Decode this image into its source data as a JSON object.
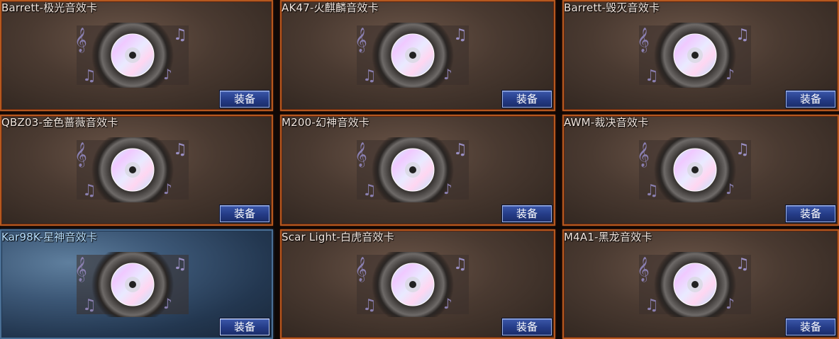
{
  "cards": [
    {
      "title": "Barrett-极光音效卡",
      "button": "装备",
      "icon": "music-disc-icon",
      "selected": false
    },
    {
      "title": "AK47-火麒麟音效卡",
      "button": "装备",
      "icon": "music-disc-icon",
      "selected": false
    },
    {
      "title": "Barrett-毁灭音效卡",
      "button": "装备",
      "icon": "music-disc-icon",
      "selected": false
    },
    {
      "title": "QBZ03-金色蔷薇音效卡",
      "button": "装备",
      "icon": "music-disc-icon",
      "selected": false
    },
    {
      "title": "M200-幻神音效卡",
      "button": "装备",
      "icon": "music-disc-icon",
      "selected": false
    },
    {
      "title": "AWM-裁决音效卡",
      "button": "装备",
      "icon": "music-disc-icon",
      "selected": false
    },
    {
      "title": "Kar98K-星神音效卡",
      "button": "装备",
      "icon": "music-disc-icon",
      "selected": true
    },
    {
      "title": "Scar Light-白虎音效卡",
      "button": "装备",
      "icon": "music-disc-icon",
      "selected": false
    },
    {
      "title": "M4A1-黑龙音效卡",
      "button": "装备",
      "icon": "music-disc-icon",
      "selected": false
    }
  ],
  "colors": {
    "card_border": "#b5581f",
    "selected_border": "#4a6f95",
    "button_fill": "#243b86",
    "title_text": "#f3e6de",
    "selected_title_text": "#b9e0ff"
  }
}
